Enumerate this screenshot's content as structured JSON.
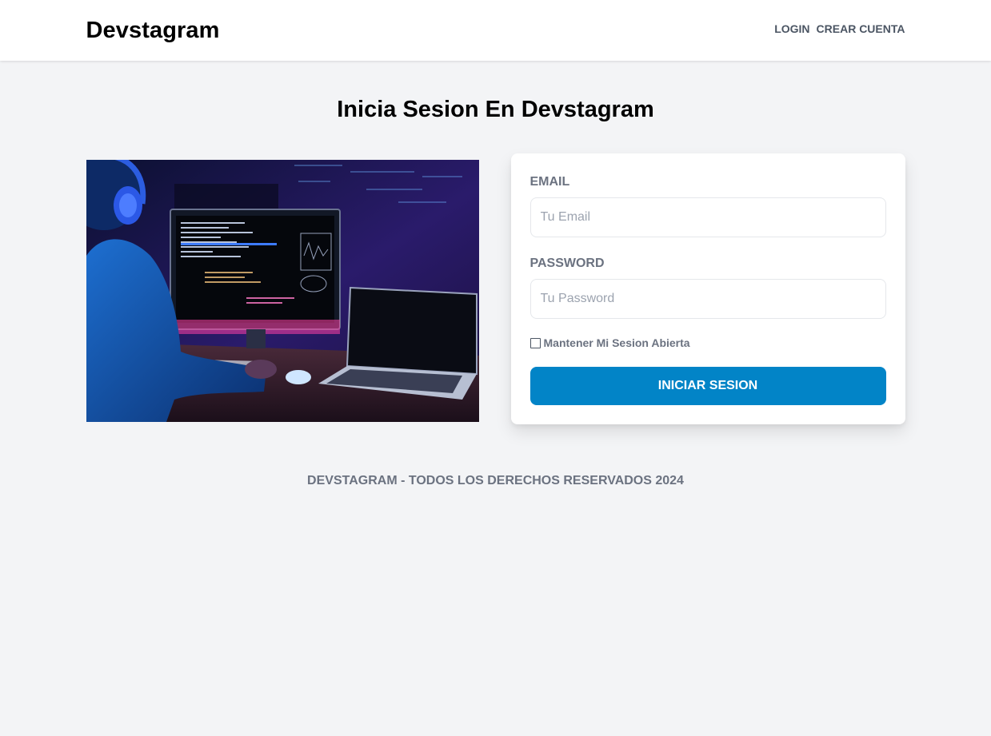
{
  "header": {
    "brand": "Devstagram",
    "nav": {
      "login": "Login",
      "register": "Crear Cuenta"
    }
  },
  "main": {
    "title": "Inicia Sesion En Devstagram",
    "image": {
      "subject": "developer-at-computer-photo"
    },
    "form": {
      "email_label": "Email",
      "email_placeholder": "Tu Email",
      "email_value": "",
      "password_label": "Password",
      "password_placeholder": "Tu Password",
      "password_value": "",
      "remember_label": "Mantener Mi Sesion Abierta",
      "remember_checked": false,
      "submit_label": "Iniciar Sesion"
    }
  },
  "footer": {
    "text": "Devstagram - Todos los derechos reservados 2024"
  },
  "colors": {
    "background": "#f3f4f6",
    "primary_button": "#0284c7",
    "muted_text": "#6b7280"
  }
}
